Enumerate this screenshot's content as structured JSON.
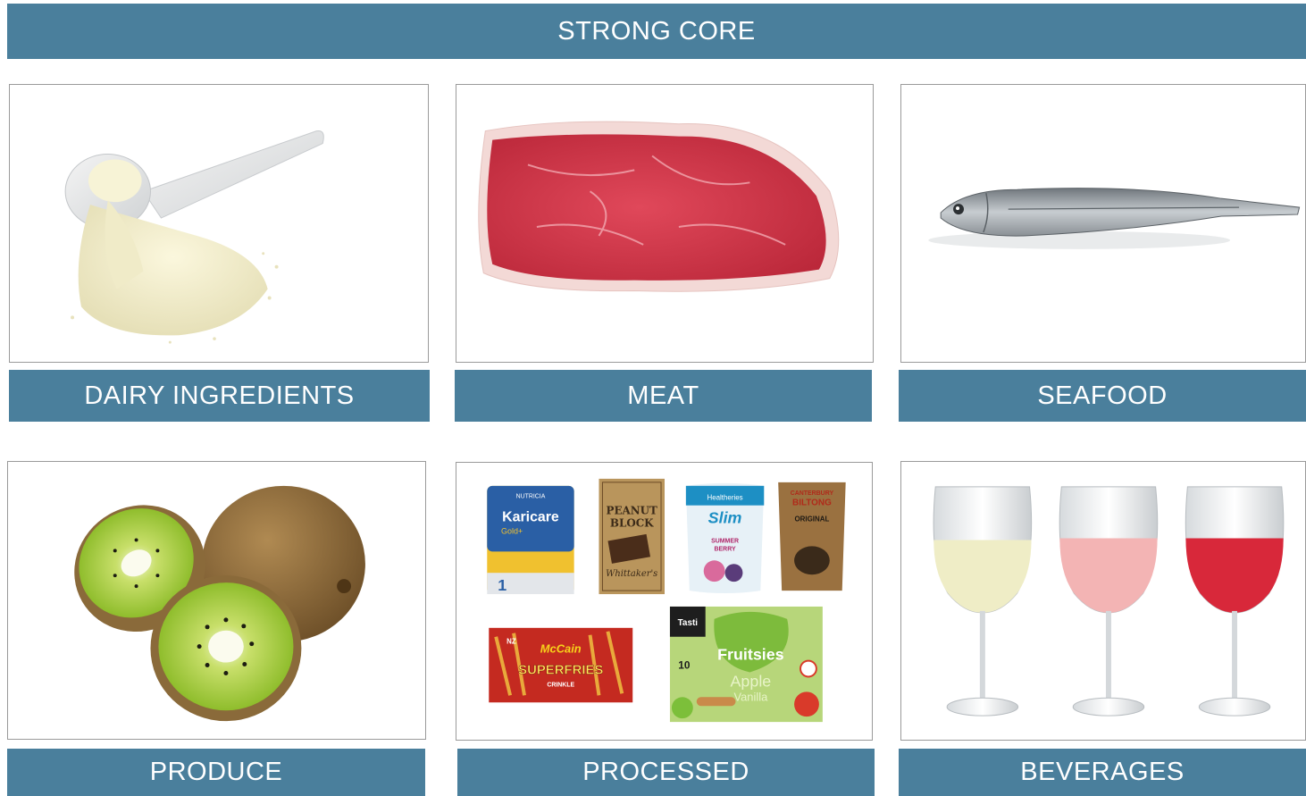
{
  "header": {
    "title": "STRONG CORE"
  },
  "categories": [
    {
      "label": "DAIRY INGREDIENTS"
    },
    {
      "label": "MEAT"
    },
    {
      "label": "SEAFOOD"
    },
    {
      "label": "PRODUCE"
    },
    {
      "label": "PROCESSED"
    },
    {
      "label": "BEVERAGES"
    }
  ],
  "processed_products": {
    "karicare": {
      "brand": "NUTRICIA",
      "name": "Karicare",
      "tag": "Gold+",
      "stage": "1"
    },
    "peanut_block": {
      "line1": "PEANUT",
      "line2": "BLOCK",
      "brand": "Whittaker's"
    },
    "healtheries": {
      "brand": "Healtheries",
      "name": "Slim",
      "flavor1": "SUMMER",
      "flavor2": "BERRY"
    },
    "biltong": {
      "line1": "CANTERBURY",
      "line2": "BILTONG",
      "line3": "ORIGINAL"
    },
    "mccain": {
      "brand": "McCain",
      "name": "SUPERFRIES",
      "variant": "CRINKLE",
      "badge": "NZ"
    },
    "tasti": {
      "brand": "Tasti",
      "name": "Fruitsies",
      "flavor1": "Apple",
      "flavor2": "Vanilla",
      "count": "10"
    }
  },
  "colors": {
    "accent_bar": "#4a7f9c",
    "tile_border": "#9a9a9a",
    "bar_text": "#ffffff"
  }
}
